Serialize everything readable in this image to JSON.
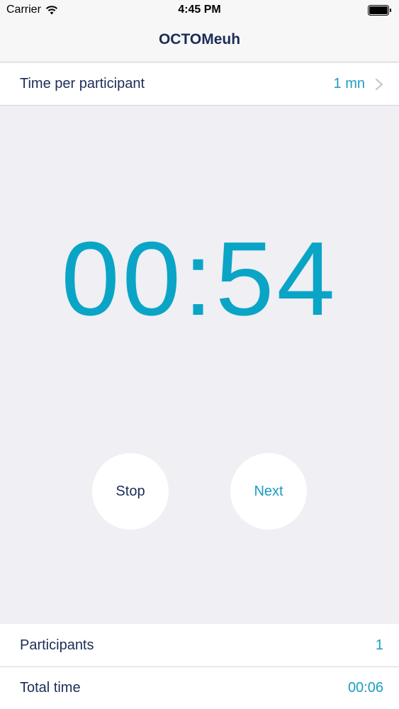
{
  "status_bar": {
    "carrier": "Carrier",
    "time": "4:45 PM",
    "wifi_icon": "wifi-icon",
    "battery_icon": "battery-icon"
  },
  "nav": {
    "title": "OCTOMeuh"
  },
  "settings": {
    "time_per_participant_label": "Time per participant",
    "time_per_participant_value": "1 mn",
    "chevron_icon": "chevron-right-icon"
  },
  "timer": {
    "display": "00:54"
  },
  "controls": {
    "stop_label": "Stop",
    "next_label": "Next"
  },
  "summary": {
    "participants_label": "Participants",
    "participants_value": "1",
    "total_time_label": "Total time",
    "total_time_value": "00:06"
  },
  "colors": {
    "accent": "#0aa5c6",
    "text_dark": "#1b2d57",
    "background": "#efeff4"
  }
}
